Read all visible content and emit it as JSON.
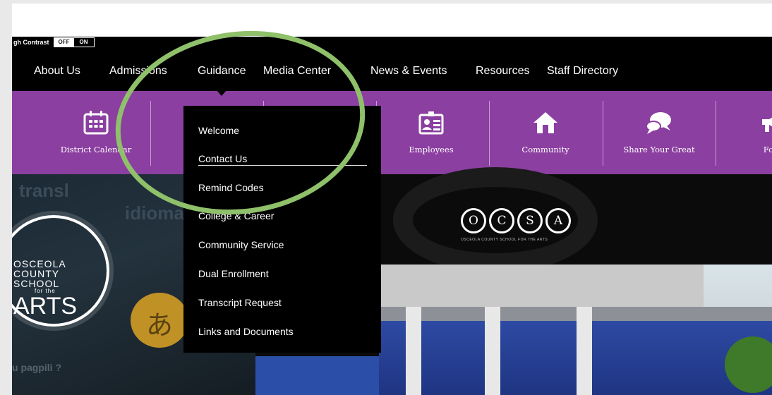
{
  "high_contrast": {
    "label": "gh Contrast",
    "off": "OFF",
    "on": "ON"
  },
  "nav": {
    "items": [
      {
        "label": "About Us"
      },
      {
        "label": "Admissions"
      },
      {
        "label": "Guidance"
      },
      {
        "label": "Media Center"
      },
      {
        "label": "News & Events"
      },
      {
        "label": "Resources"
      },
      {
        "label": "Staff Directory"
      }
    ]
  },
  "quicklinks": [
    {
      "label": "District Calendar",
      "icon": "calendar-icon"
    },
    {
      "label": "Employees",
      "icon": "id-badge-icon"
    },
    {
      "label": "Community",
      "icon": "home-icon"
    },
    {
      "label": "Share Your Great",
      "icon": "chat-bubbles-icon"
    },
    {
      "label": "Fort",
      "icon": "megaphone-icon"
    }
  ],
  "dropdown": {
    "items": [
      {
        "label": "Welcome"
      },
      {
        "label": "Contact Us"
      },
      {
        "label": "Remind Codes"
      },
      {
        "label": "College & Career"
      },
      {
        "label": "Community Service"
      },
      {
        "label": "Dual Enrollment"
      },
      {
        "label": "Transcript Request"
      },
      {
        "label": "Links and Documents"
      }
    ]
  },
  "hero": {
    "logo": {
      "line1": "OSCEOLA",
      "line2": "COUNTY",
      "line3": "SCHOOL",
      "line4": "for the",
      "line5": "ARTS"
    },
    "ocsa": {
      "letters": [
        "O",
        "C",
        "S",
        "A"
      ],
      "subtitle": "OSCEOLA COUNTY SCHOOL FOR THE ARTS"
    },
    "ghost_text_1": "transl",
    "ghost_text_2": "idioma",
    "ghost_text_3": "u pagpili ?",
    "bubble_char": "あ"
  },
  "colors": {
    "purple": "#8b3fa0",
    "annotation": "#8fc06a"
  }
}
